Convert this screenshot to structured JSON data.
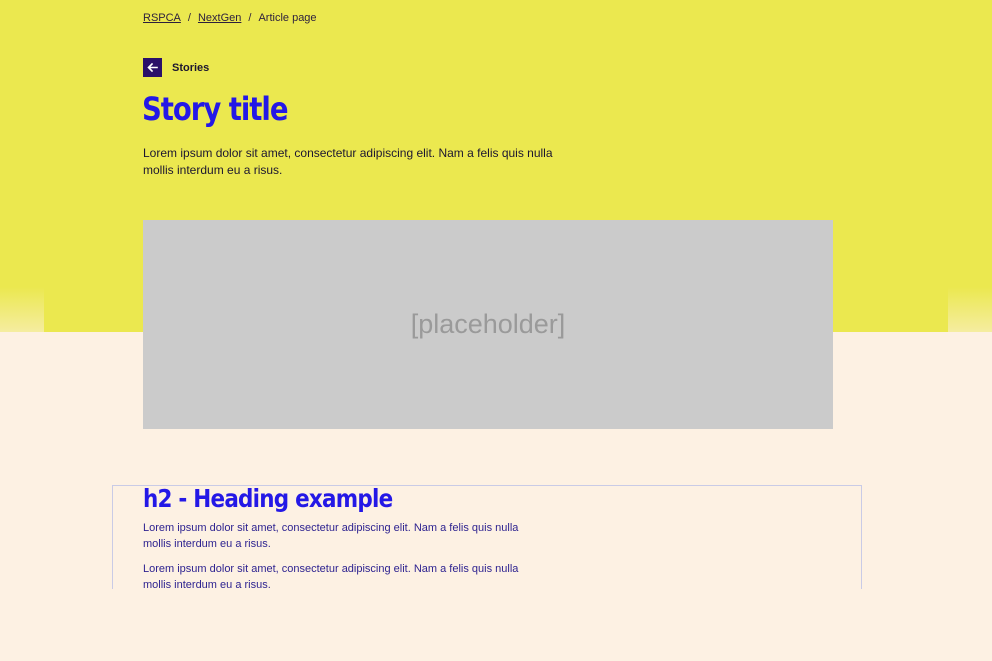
{
  "breadcrumb": {
    "items": [
      {
        "label": "RSPCA",
        "link": true
      },
      {
        "label": "NextGen",
        "link": true
      },
      {
        "label": "Article page",
        "link": false
      }
    ],
    "separator": "/"
  },
  "back": {
    "label": "Stories",
    "icon": "arrow-left-icon"
  },
  "hero": {
    "title": "Story title",
    "lead": "Lorem ipsum dolor sit amet, consectetur adipiscing elit. Nam a felis quis nulla mollis interdum eu a risus.",
    "image_placeholder": "[placeholder]"
  },
  "content": {
    "heading": "h2 - Heading example",
    "paragraphs": [
      "Lorem ipsum dolor sit amet, consectetur adipiscing elit. Nam a felis quis nulla mollis interdum eu a risus.",
      "Lorem ipsum dolor sit amet, consectetur adipiscing elit. Nam a felis quis nulla mollis interdum eu a risus."
    ]
  },
  "colors": {
    "hero_background": "#ebe84f",
    "page_background": "#fdf1e3",
    "heading_blue": "#2418e6",
    "back_icon_bg": "#2a1069",
    "image_placeholder_bg": "#cbcbcb"
  }
}
